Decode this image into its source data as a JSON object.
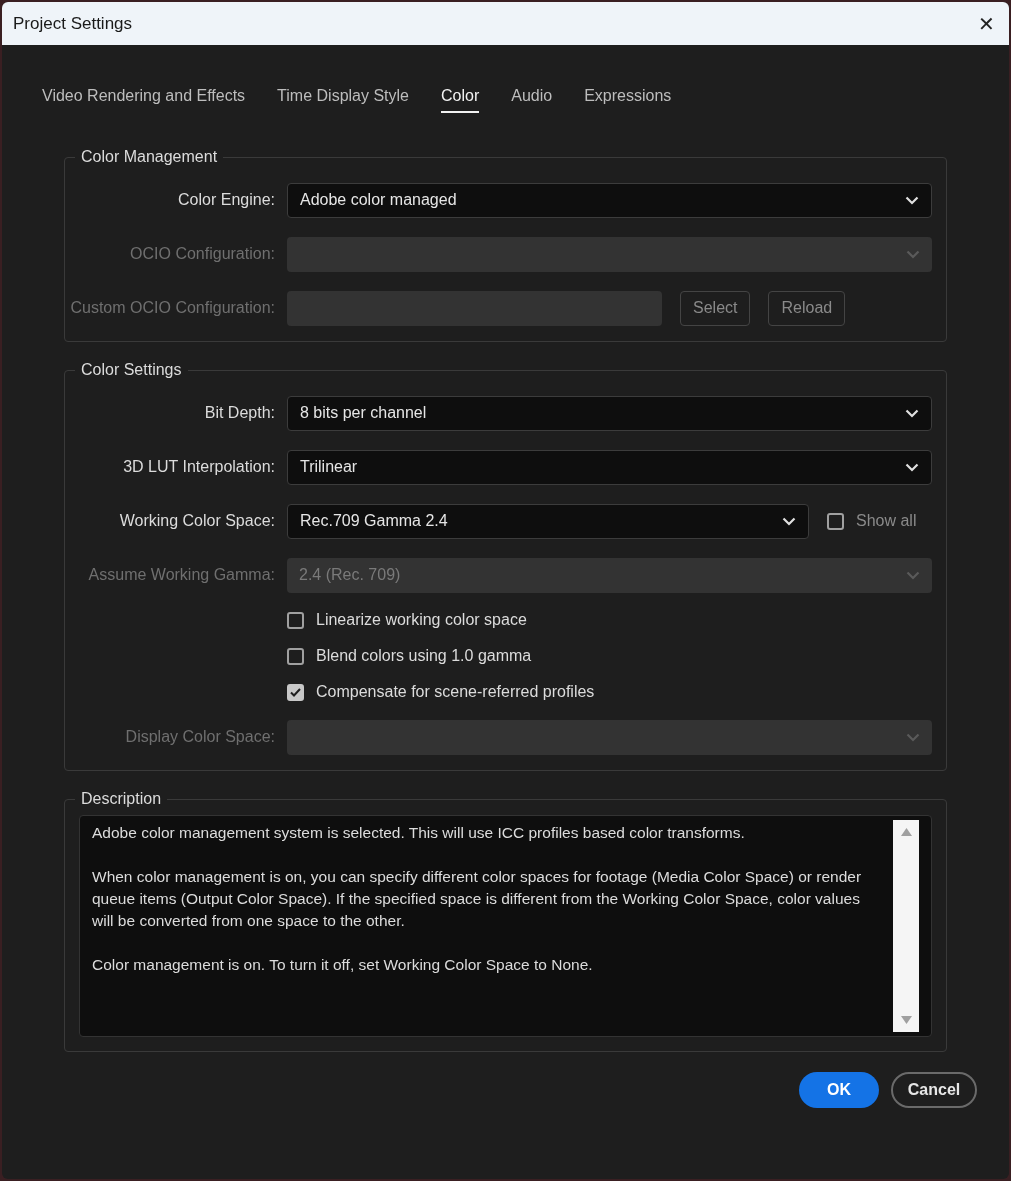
{
  "window": {
    "title": "Project Settings",
    "close": "✕"
  },
  "tabs": [
    {
      "label": "Video Rendering and Effects",
      "selected": false
    },
    {
      "label": "Time Display Style",
      "selected": false
    },
    {
      "label": "Color",
      "selected": true
    },
    {
      "label": "Audio",
      "selected": false
    },
    {
      "label": "Expressions",
      "selected": false
    }
  ],
  "groups": [
    {
      "title": "Color Management",
      "rows": [
        {
          "kind": "select",
          "label": "Color Engine:",
          "value": "Adobe color managed",
          "disabled": false
        },
        {
          "kind": "select",
          "label": "OCIO Configuration:",
          "disabled": true
        },
        {
          "kind": "path",
          "label": "Custom OCIO Configuration:",
          "disabled": true,
          "buttons": [
            "Select",
            "Reload"
          ]
        }
      ]
    },
    {
      "title": "Color Settings",
      "rows": [
        {
          "kind": "select",
          "label": "Bit Depth:",
          "value": "8 bits per channel",
          "disabled": false
        },
        {
          "kind": "select",
          "label": "3D LUT Interpolation:",
          "value": "Trilinear",
          "disabled": false
        },
        {
          "kind": "select",
          "label": "Working Color Space:",
          "value": "Rec.709 Gamma 2.4",
          "disabled": false,
          "side_checkbox": {
            "label": "Show all",
            "checked": false
          }
        },
        {
          "kind": "select",
          "label": "Assume Working Gamma:",
          "value": "2.4 (Rec. 709)",
          "disabled": true
        },
        {
          "kind": "checkbox",
          "label": "Linearize working color space",
          "checked": false
        },
        {
          "kind": "checkbox",
          "label": "Blend colors using 1.0 gamma",
          "checked": false
        },
        {
          "kind": "checkbox",
          "label": "Compensate for scene-referred profiles",
          "checked": true
        },
        {
          "kind": "select",
          "label": "Display Color Space:",
          "disabled": true
        }
      ]
    }
  ],
  "description": {
    "title": "Description",
    "paragraphs": [
      "Adobe color management system is selected. This will use ICC profiles based color transforms.",
      "When color management is on, you can specify different color spaces for footage (Media Color Space) or render queue items (Output Color Space). If the specified space is different from the Working Color Space, color values will be converted from one space to the other.",
      "Color management is on. To turn it off, set Working Color Space to None."
    ]
  },
  "buttons": [
    {
      "label": "OK",
      "kind": "primary"
    },
    {
      "label": "Cancel",
      "kind": "secondary"
    }
  ]
}
